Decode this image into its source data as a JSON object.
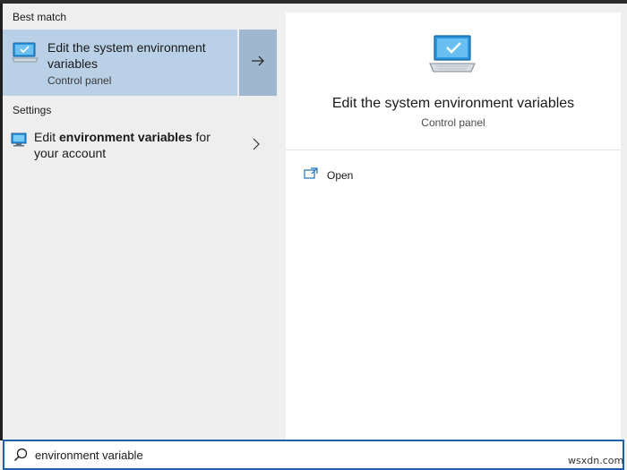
{
  "left_pane": {
    "best_match_header": "Best match",
    "best_match": {
      "title": "Edit the system environment variables",
      "subtitle": "Control panel",
      "icon": "monitor-checkmark-icon",
      "arrow_icon": "arrow-right-icon"
    },
    "settings_header": "Settings",
    "settings_item": {
      "label_prefix": "Edit ",
      "label_bold": "environment variables",
      "label_suffix": " for your account",
      "icon": "monitor-settings-icon",
      "chevron_icon": "chevron-right-icon"
    }
  },
  "right_pane": {
    "title": "Edit the system environment variables",
    "subtitle": "Control panel",
    "icon": "monitor-checkmark-icon",
    "actions": [
      {
        "label": "Open",
        "icon": "open-window-icon"
      }
    ]
  },
  "search": {
    "value": "environment variable",
    "icon": "search-icon"
  },
  "watermark": "wsxdn.com",
  "colors": {
    "selected_bg": "#b9d0e7",
    "arrow_bg": "#9fb7cf",
    "search_border": "#1d5fa8",
    "icon_blue": "#1e8ad6"
  }
}
